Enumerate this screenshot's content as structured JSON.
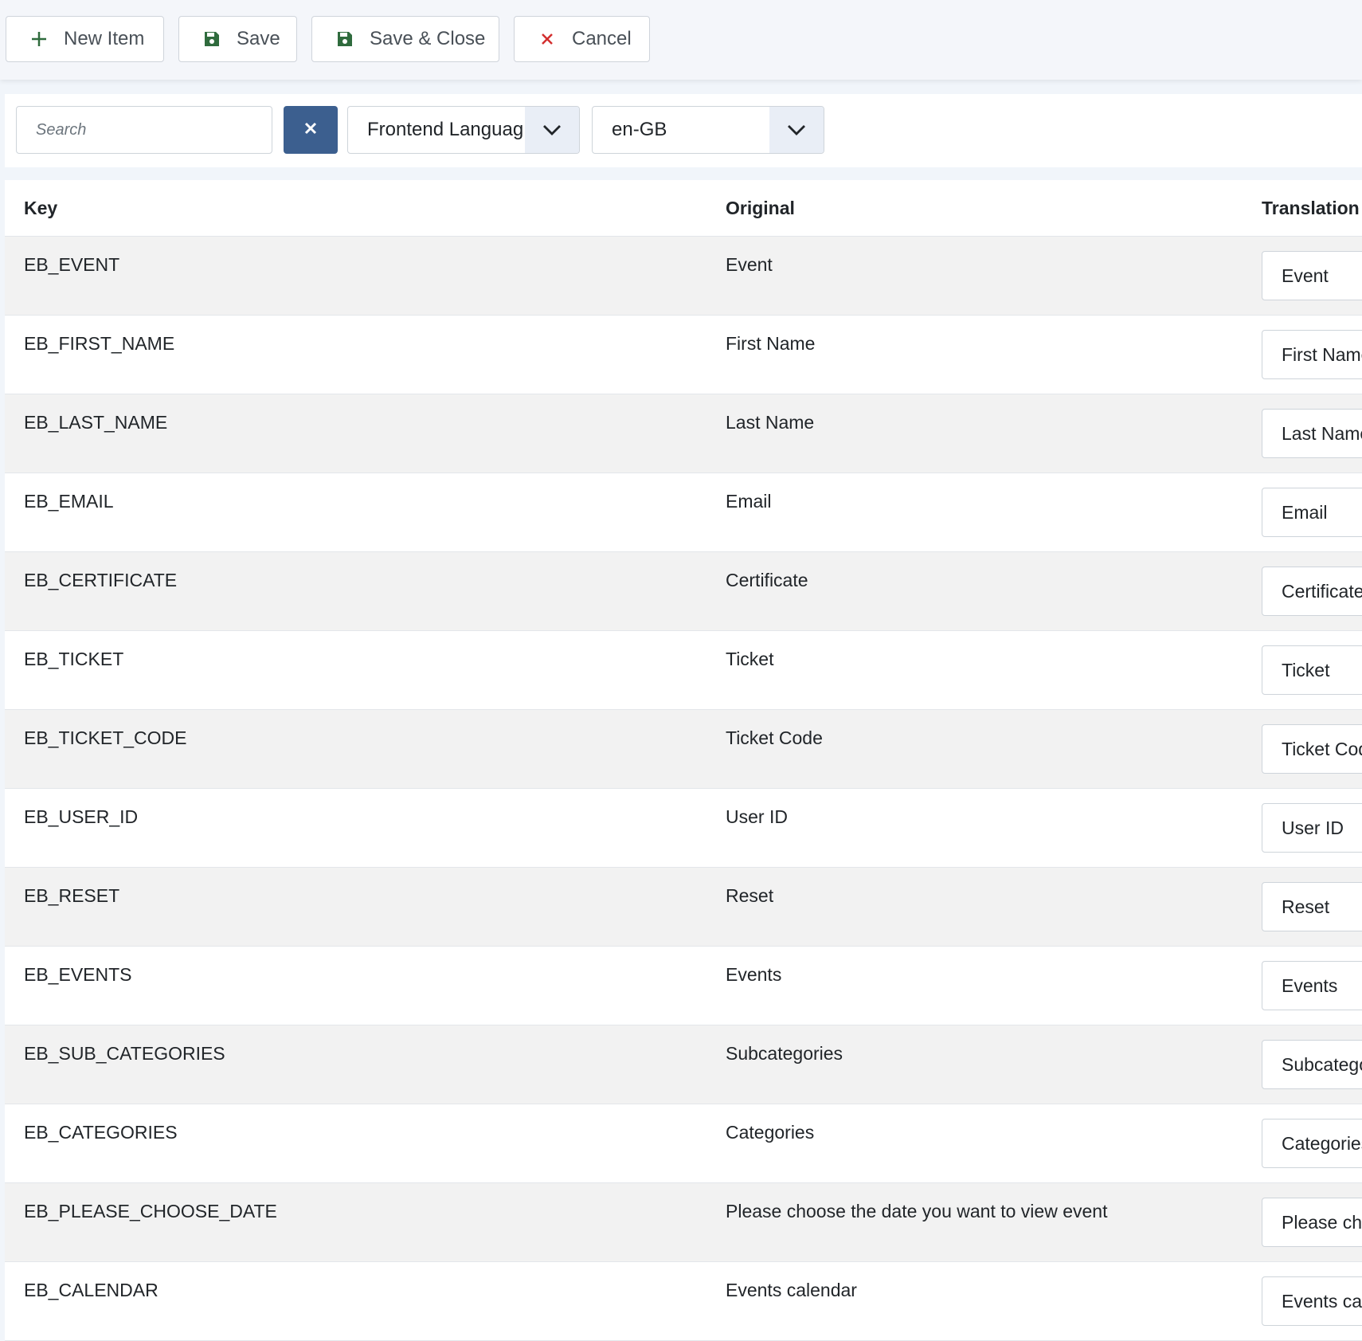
{
  "toolbar": {
    "new_item_label": "New Item",
    "save_label": "Save",
    "save_close_label": "Save & Close",
    "cancel_label": "Cancel"
  },
  "filters": {
    "search_placeholder": "Search",
    "language_type": "Frontend Languag",
    "language_code": "en-GB"
  },
  "table": {
    "headers": {
      "key": "Key",
      "original": "Original",
      "translation": "Translation"
    },
    "rows": [
      {
        "key": "EB_EVENT",
        "original": "Event",
        "translation": "Event"
      },
      {
        "key": "EB_FIRST_NAME",
        "original": "First Name",
        "translation": "First Name"
      },
      {
        "key": "EB_LAST_NAME",
        "original": "Last Name",
        "translation": "Last Name"
      },
      {
        "key": "EB_EMAIL",
        "original": "Email",
        "translation": "Email"
      },
      {
        "key": "EB_CERTIFICATE",
        "original": "Certificate",
        "translation": "Certificate"
      },
      {
        "key": "EB_TICKET",
        "original": "Ticket",
        "translation": "Ticket"
      },
      {
        "key": "EB_TICKET_CODE",
        "original": "Ticket Code",
        "translation": "Ticket Code"
      },
      {
        "key": "EB_USER_ID",
        "original": "User ID",
        "translation": "User ID"
      },
      {
        "key": "EB_RESET",
        "original": "Reset",
        "translation": "Reset"
      },
      {
        "key": "EB_EVENTS",
        "original": "Events",
        "translation": "Events"
      },
      {
        "key": "EB_SUB_CATEGORIES",
        "original": "Subcategories",
        "translation": "Subcategories"
      },
      {
        "key": "EB_CATEGORIES",
        "original": "Categories",
        "translation": "Categories"
      },
      {
        "key": "EB_PLEASE_CHOOSE_DATE",
        "original": "Please choose the date you want to view event",
        "translation": "Please choose the date you want to view event"
      },
      {
        "key": "EB_CALENDAR",
        "original": "Events calendar",
        "translation": "Events calendar"
      }
    ]
  },
  "colors": {
    "accent_button": "#3c5f8f",
    "save_icon": "#2f6b3d",
    "cancel_icon": "#d32f2f",
    "row_stripe": "#f2f2f2"
  }
}
